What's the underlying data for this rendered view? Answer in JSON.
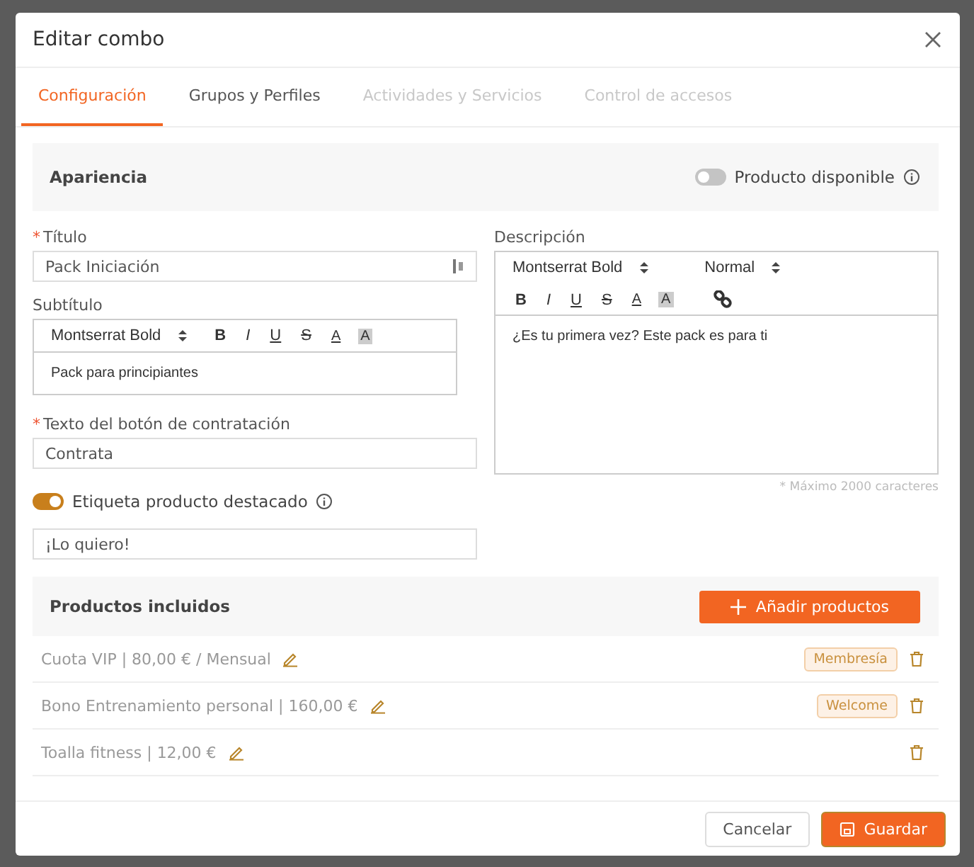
{
  "window": {
    "title": "Editar combo"
  },
  "required_mark": "*",
  "tabs": [
    {
      "label": "Configuración",
      "selected": true,
      "disabled": false
    },
    {
      "label": "Grupos y Perfiles",
      "selected": false,
      "disabled": false
    },
    {
      "label": "Actividades y Servicios",
      "selected": false,
      "disabled": true
    },
    {
      "label": "Control de accesos",
      "selected": false,
      "disabled": true
    }
  ],
  "appearance": {
    "title": "Apariencia",
    "toggle": {
      "label": "Producto disponible",
      "on": false
    }
  },
  "title_field": {
    "label": "Título",
    "required": true,
    "value": "Pack Iniciación"
  },
  "subtitle_field": {
    "label": "Subtítulo",
    "font": "Montserrat Bold",
    "value": "Pack para principiantes",
    "format_buttons": [
      {
        "char": "B",
        "kind": "bold"
      },
      {
        "char": "I",
        "kind": "italic"
      },
      {
        "char": "U",
        "kind": "underline"
      },
      {
        "char": "S",
        "kind": "strike"
      },
      {
        "char": "A",
        "kind": "color"
      },
      {
        "char": "A",
        "kind": "background"
      }
    ]
  },
  "button_text_field": {
    "label": "Texto del botón de contratación",
    "required": true,
    "value": "Contrata"
  },
  "featured": {
    "label": "Etiqueta producto destacado",
    "on": true,
    "value": "¡Lo quiero!"
  },
  "description_field": {
    "label": "Descripción",
    "font": "Montserrat Bold",
    "size": "Normal",
    "value": "¿Es tu primera vez? Este pack es para ti",
    "hint": "* Máximo 2000 caracteres",
    "format_buttons": [
      {
        "char": "B",
        "kind": "bold"
      },
      {
        "char": "I",
        "kind": "italic"
      },
      {
        "char": "U",
        "kind": "underline"
      },
      {
        "char": "S",
        "kind": "strike"
      },
      {
        "char": "A",
        "kind": "color"
      },
      {
        "char": "A",
        "kind": "background"
      }
    ]
  },
  "included": {
    "title": "Productos incluidos",
    "add_button": "Añadir productos",
    "items": [
      {
        "text": "Cuota VIP | 80,00 € /  Mensual",
        "tag": "Membresía"
      },
      {
        "text": "Bono Entrenamiento personal | 160,00 €",
        "tag": "Welcome"
      },
      {
        "text": "Toalla fitness | 12,00 €"
      }
    ]
  },
  "footer": {
    "buttons": [
      {
        "label": "Cancelar",
        "kind": "secondary"
      },
      {
        "label": "Guardar",
        "kind": "primary"
      }
    ]
  }
}
